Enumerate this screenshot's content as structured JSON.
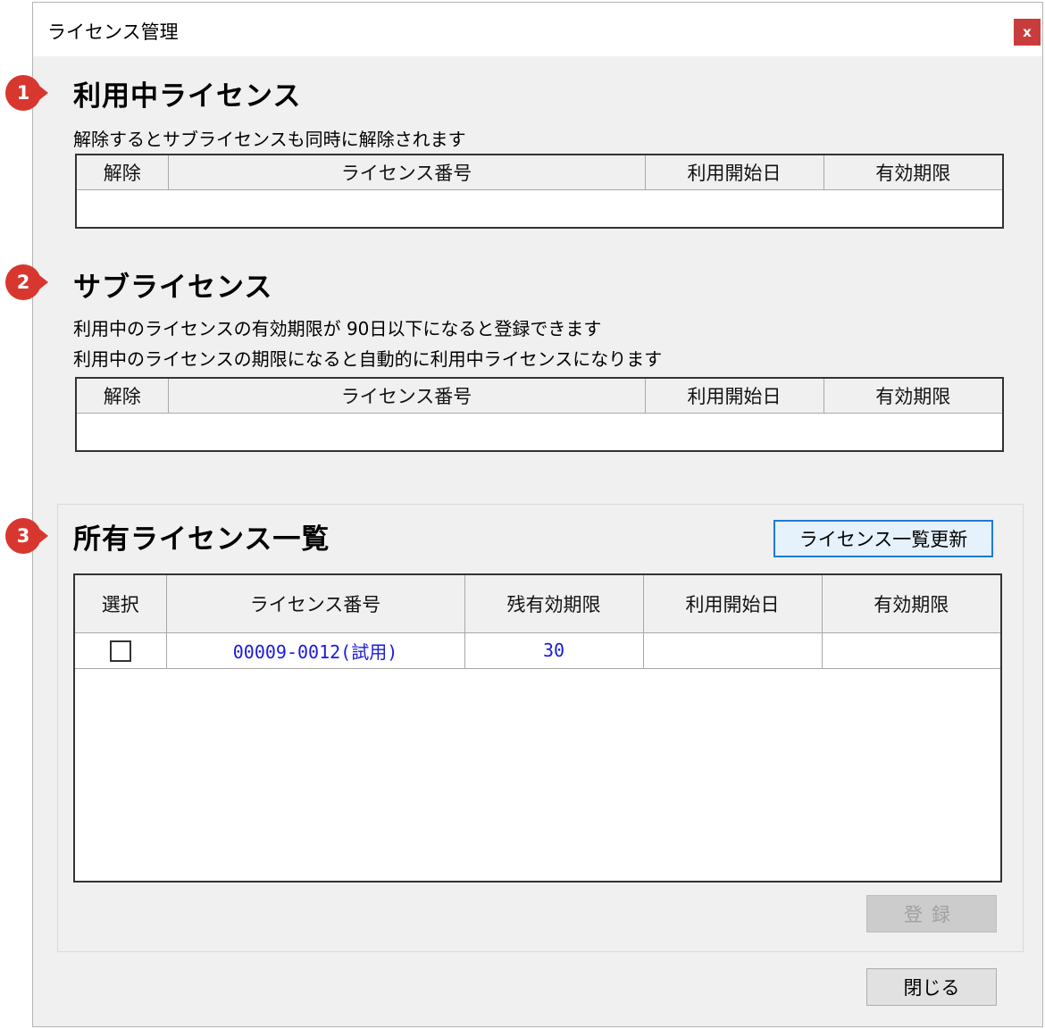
{
  "window": {
    "title": "ライセンス管理",
    "close_label": "x"
  },
  "section1": {
    "marker": "1",
    "heading": "利用中ライセンス",
    "note": "解除するとサブライセンスも同時に解除されます",
    "columns": [
      "解除",
      "ライセンス番号",
      "利用開始日",
      "有効期限"
    ]
  },
  "section2": {
    "marker": "2",
    "heading": "サブライセンス",
    "note1": "利用中のライセンスの有効期限が 90日以下になると登録できます",
    "note2": "利用中のライセンスの期限になると自動的に利用中ライセンスになります",
    "columns": [
      "解除",
      "ライセンス番号",
      "利用開始日",
      "有効期限"
    ]
  },
  "section3": {
    "marker": "3",
    "heading": "所有ライセンス一覧",
    "refresh_button": "ライセンス一覧更新",
    "columns": [
      "選択",
      "ライセンス番号",
      "残有効期限",
      "利用開始日",
      "有効期限"
    ],
    "rows": [
      {
        "selected": false,
        "license_number": "00009-0012(試用)",
        "remaining": "30",
        "start_date": "",
        "expiry": ""
      }
    ],
    "register_button": "登録"
  },
  "footer": {
    "close_button": "閉じる"
  },
  "colors": {
    "marker": "#d7372f",
    "link_text": "#1a1ae0",
    "focus_border": "#1e7ad6"
  }
}
